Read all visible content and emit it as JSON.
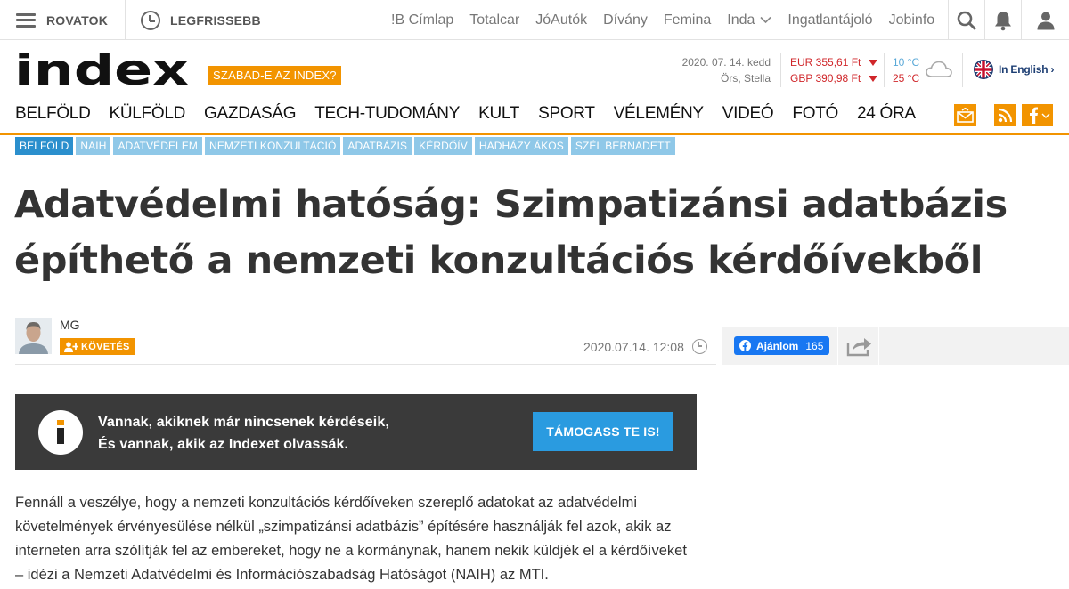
{
  "topbar": {
    "rovatok": "ROVATOK",
    "legfrissebb": "LEGFRISSEBB",
    "partners": [
      "!B Címlap",
      "Totalcar",
      "JóAutók",
      "Dívány",
      "Femina",
      "Inda",
      "Ingatlantájoló",
      "Jobinfo"
    ],
    "icons": [
      "search-icon",
      "bell-icon",
      "user-icon"
    ]
  },
  "header": {
    "logo": "index",
    "szabad": "SZABAD-E AZ INDEX?",
    "date": "2020. 07. 14. kedd",
    "nameday": "Örs, Stella",
    "eur": "EUR 355,61 Ft",
    "gbp": "GBP 390,98 Ft",
    "temp_low": "10 °C",
    "temp_high": "25 °C",
    "english": "In English ›"
  },
  "nav": {
    "items": [
      "BELFÖLD",
      "KÜLFÖLD",
      "GAZDASÁG",
      "TECH-TUDOMÁNY",
      "KULT",
      "SPORT",
      "VÉLEMÉNY",
      "VIDEÓ",
      "FOTÓ",
      "24 ÓRA"
    ]
  },
  "tags": [
    "BELFÖLD",
    "NAIH",
    "ADATVÉDELEM",
    "NEMZETI KONZULTÁCIÓ",
    "ADATBÁZIS",
    "KÉRDŐÍV",
    "HADHÁZY ÁKOS",
    "SZÉL BERNADETT"
  ],
  "article": {
    "title_line1": "Adatvédelmi hatóság: Szimpatizánsi adatbázis",
    "title_line2": "építhető a nemzeti konzultációs kérdőívekből",
    "author": "MG",
    "follow": "KÖVETÉS",
    "date": "2020.07.14. 12:08",
    "fb_label": "Ajánlom",
    "fb_count": "165",
    "lead": "Fennáll a veszélye, hogy a nemzeti konzultációs kérdőíveken szereplő adatokat az adatvédelmi követelmények érvényesülése nélkül „szimpatizánsi adatbázis” építésére használják fel azok, akik az interneten arra szólítják fel az embereket, hogy ne a kormánynak, hanem nekik küldjék el a kérdőíveket – idézi a Nemzeti Adatvédelmi és Információszabadság Hatóságot (NAIH) az MTI."
  },
  "banner": {
    "line1": "Vannak, akiknek már nincsenek kérdéseik,",
    "line2": "És vannak, akik az Indexet olvassák.",
    "button": "TÁMOGASS TE IS!"
  },
  "colors": {
    "accent": "#f29400",
    "tag_primary": "#2b8fcd",
    "tag": "#8fc8e8",
    "banner": "#3a3a3a",
    "button": "#2a9be0",
    "fx": "#d0262a"
  }
}
